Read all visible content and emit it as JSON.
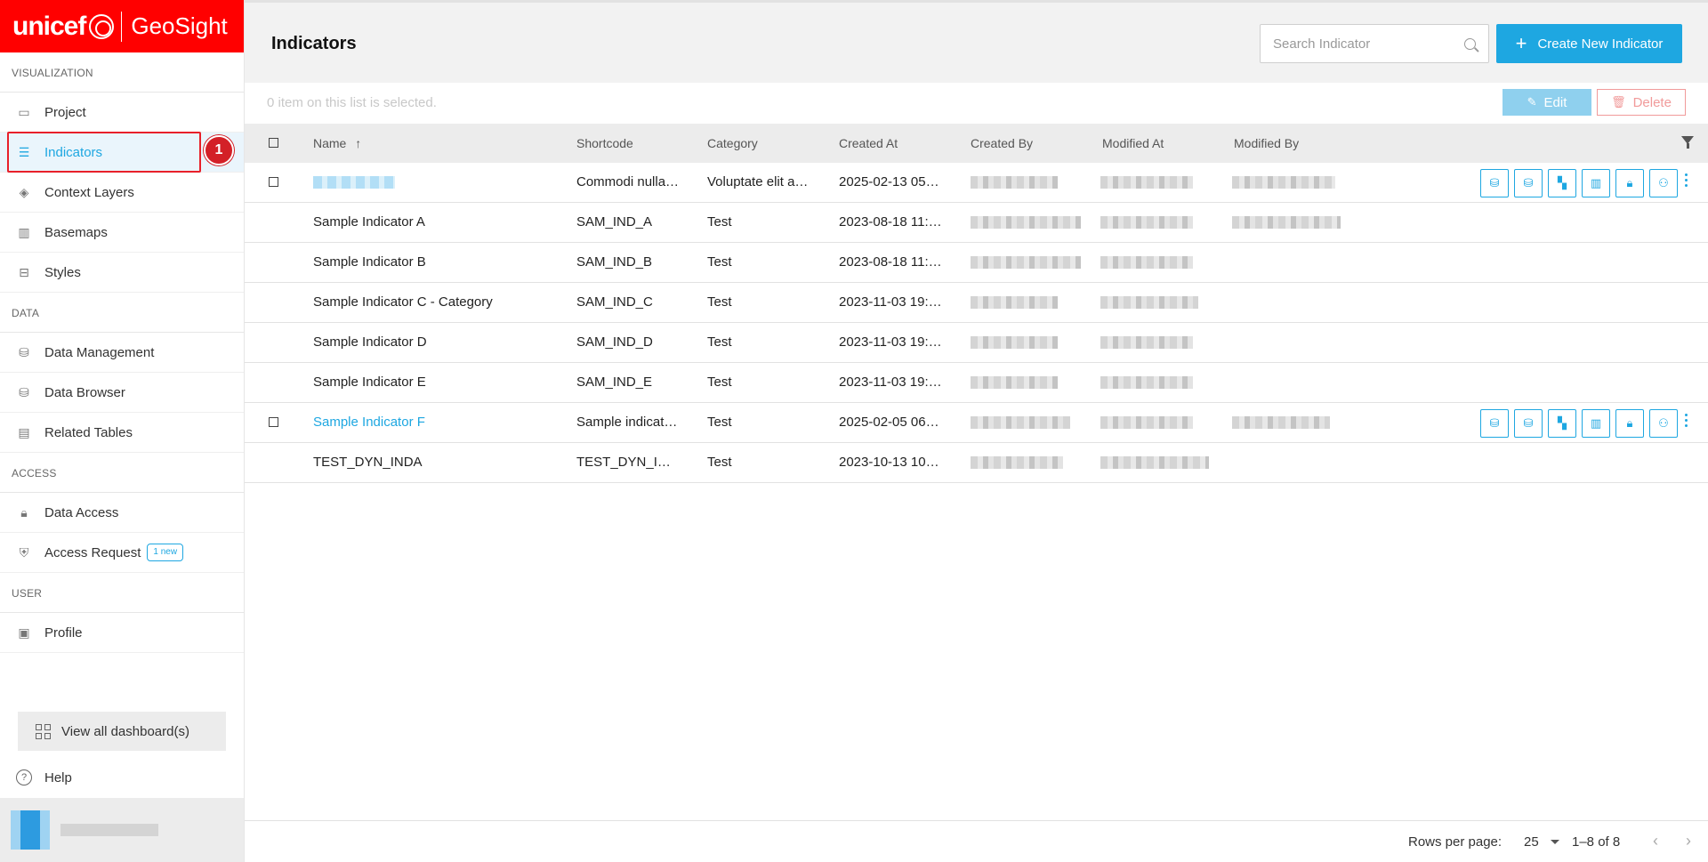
{
  "brand": {
    "logo": "unicef",
    "app_name": "GeoSight"
  },
  "sidebar": {
    "sections": [
      {
        "label": "VISUALIZATION",
        "items": [
          {
            "label": "Project",
            "icon": "folder-icon"
          },
          {
            "label": "Indicators",
            "icon": "list-icon",
            "active": true
          },
          {
            "label": "Context Layers",
            "icon": "layers-icon"
          },
          {
            "label": "Basemaps",
            "icon": "map-icon"
          },
          {
            "label": "Styles",
            "icon": "paint-roller-icon"
          }
        ]
      },
      {
        "label": "DATA",
        "items": [
          {
            "label": "Data Management",
            "icon": "database-icon"
          },
          {
            "label": "Data Browser",
            "icon": "database-icon"
          },
          {
            "label": "Related Tables",
            "icon": "table-icon"
          }
        ]
      },
      {
        "label": "ACCESS",
        "items": [
          {
            "label": "Data Access",
            "icon": "lock-icon"
          },
          {
            "label": "Access Request",
            "icon": "shield-icon",
            "badge": "1 new"
          }
        ]
      },
      {
        "label": "USER",
        "items": [
          {
            "label": "Profile",
            "icon": "contact-book-icon"
          }
        ]
      }
    ],
    "step_badge": "1",
    "dashboards_label": "View all dashboard(s)",
    "help_label": "Help"
  },
  "header": {
    "title": "Indicators",
    "search_placeholder": "Search Indicator",
    "create_label": "Create New Indicator"
  },
  "selection": {
    "text": "0 item on this list is selected.",
    "edit_label": "Edit",
    "delete_label": "Delete"
  },
  "table": {
    "columns": [
      "Name",
      "Shortcode",
      "Category",
      "Created At",
      "Created By",
      "Modified At",
      "Modified By"
    ],
    "rows": [
      {
        "name": "",
        "shortcode": "Commodi nulla…",
        "category": "Voluptate elit a…",
        "created_at": "2025-02-13 05…",
        "selectable": true,
        "actions": true,
        "name_blurred": true,
        "modified_by": true
      },
      {
        "name": "Sample Indicator A",
        "shortcode": "SAM_IND_A",
        "category": "Test",
        "created_at": "2023-08-18 11:…",
        "modified_by": true
      },
      {
        "name": "Sample Indicator B",
        "shortcode": "SAM_IND_B",
        "category": "Test",
        "created_at": "2023-08-18 11:…"
      },
      {
        "name": "Sample Indicator C - Category",
        "shortcode": "SAM_IND_C",
        "category": "Test",
        "created_at": "2023-11-03 19:…"
      },
      {
        "name": "Sample Indicator D",
        "shortcode": "SAM_IND_D",
        "category": "Test",
        "created_at": "2023-11-03 19:…"
      },
      {
        "name": "Sample Indicator E",
        "shortcode": "SAM_IND_E",
        "category": "Test",
        "created_at": "2023-11-03 19:…"
      },
      {
        "name": "Sample Indicator F",
        "shortcode": "Sample indicat…",
        "category": "Test",
        "created_at": "2025-02-05 06…",
        "selectable": true,
        "actions": true,
        "link": true,
        "modified_by": true
      },
      {
        "name": "TEST_DYN_INDA",
        "shortcode": "TEST_DYN_I…",
        "category": "Test",
        "created_at": "2023-10-13 10…"
      }
    ]
  },
  "footer": {
    "rows_per_page_label": "Rows per page:",
    "rows_per_page": "25",
    "range": "1–8 of 8",
    "prev": "‹",
    "next": "›"
  },
  "colors": {
    "brand_red": "#ff0000",
    "accent": "#1ea7e1",
    "highlight": "#e8202a"
  }
}
